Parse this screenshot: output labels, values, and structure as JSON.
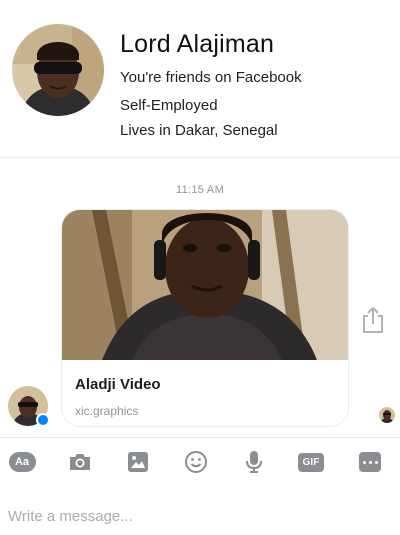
{
  "profile": {
    "name": "Lord Alajiman",
    "friend_status": "You're friends on Facebook",
    "work": "Self-Employed",
    "location": "Lives in Dakar, Senegal"
  },
  "conversation": {
    "timestamp": "11:15 AM",
    "shared_card": {
      "title": "Aladji Video",
      "source": "xic.graphics"
    }
  },
  "composer": {
    "placeholder": "Write a message...",
    "toolbar": [
      {
        "name": "text-style-icon",
        "label": "Aa"
      },
      {
        "name": "camera-icon"
      },
      {
        "name": "image-icon"
      },
      {
        "name": "emoji-icon"
      },
      {
        "name": "microphone-icon"
      },
      {
        "name": "gif-icon",
        "label": "GIF"
      },
      {
        "name": "more-icon"
      }
    ]
  },
  "colors": {
    "accent": "#0084ff",
    "toolbar_icon": "#8a8d91",
    "secondary_text": "#8d949e"
  }
}
